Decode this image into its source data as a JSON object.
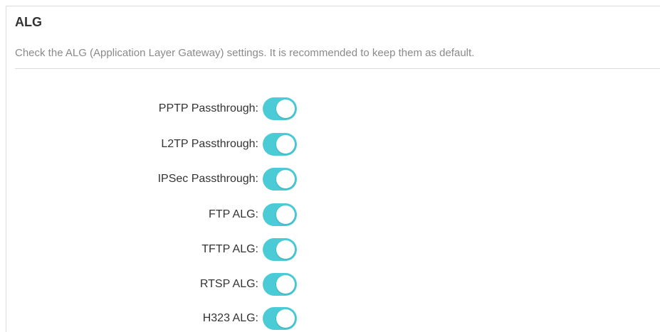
{
  "section": {
    "title": "ALG",
    "description": "Check the ALG (Application Layer Gateway) settings. It is recommended to keep them as default."
  },
  "colors": {
    "toggle_on": "#4acbd6",
    "toggle_off": "#cccccc",
    "label": "#333333",
    "description": "#8a8a8a"
  },
  "settings": [
    {
      "label": "PPTP Passthrough:",
      "enabled": true
    },
    {
      "label": "L2TP Passthrough:",
      "enabled": true
    },
    {
      "label": "IPSec Passthrough:",
      "enabled": true
    },
    {
      "label": "FTP ALG:",
      "enabled": true
    },
    {
      "label": "TFTP ALG:",
      "enabled": true
    },
    {
      "label": "RTSP ALG:",
      "enabled": true
    },
    {
      "label": "H323 ALG:",
      "enabled": true
    }
  ]
}
